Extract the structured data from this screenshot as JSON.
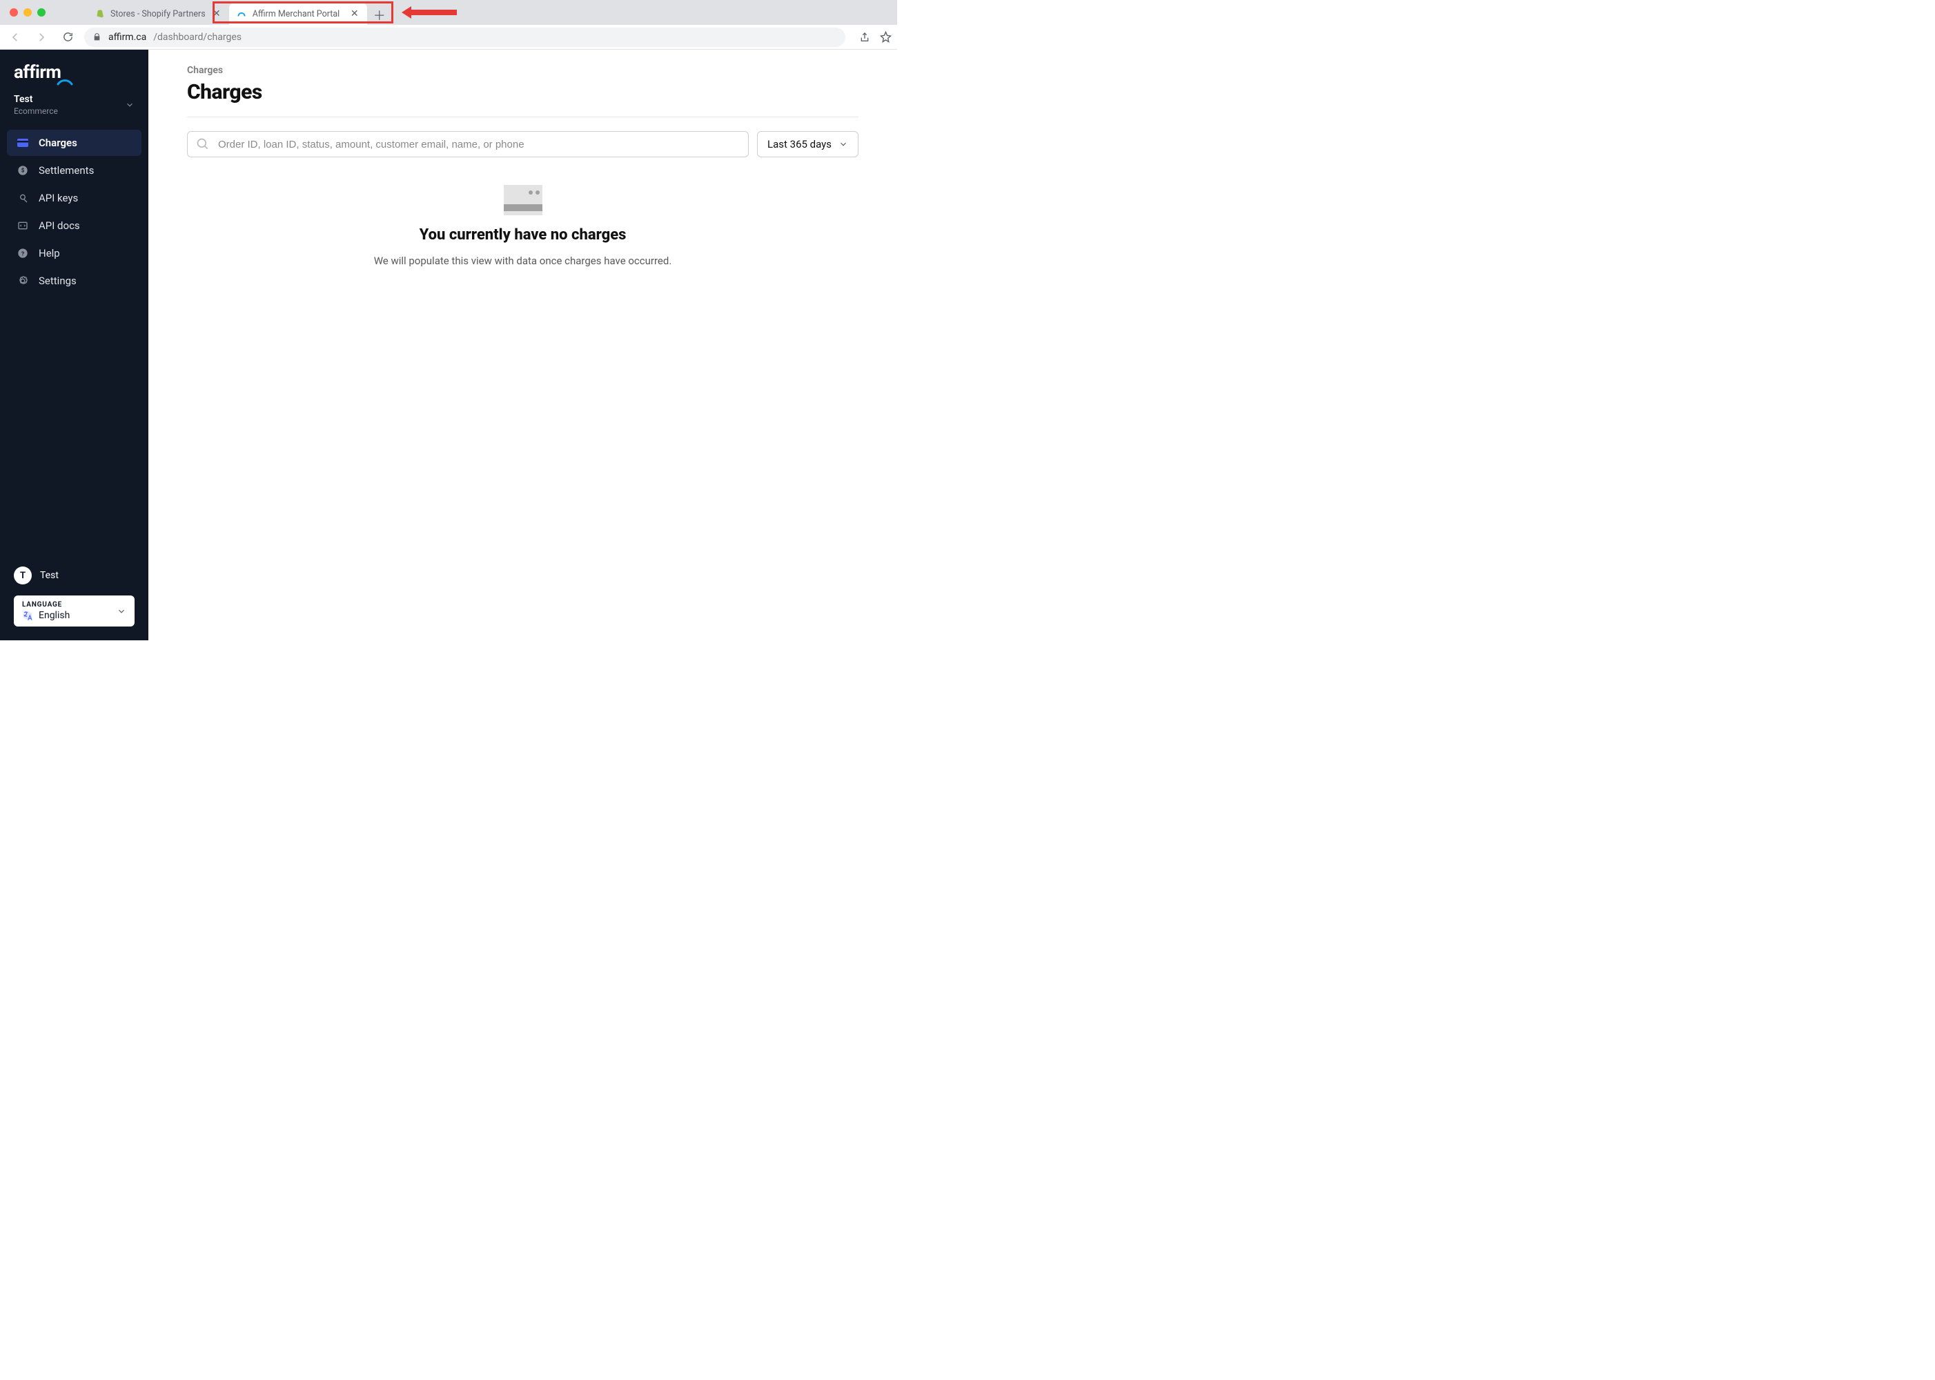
{
  "browser": {
    "tabs": [
      {
        "title": "Stores - Shopify Partners",
        "active": false
      },
      {
        "title": "Affirm Merchant Portal",
        "active": true
      }
    ],
    "url_host": "affirm.ca",
    "url_path": "/dashboard/charges"
  },
  "sidebar": {
    "brand": "affirm",
    "store": {
      "name": "Test",
      "type": "Ecommerce"
    },
    "nav": [
      {
        "key": "charges",
        "label": "Charges",
        "active": true
      },
      {
        "key": "settlements",
        "label": "Settlements"
      },
      {
        "key": "api-keys",
        "label": "API keys"
      },
      {
        "key": "api-docs",
        "label": "API docs"
      },
      {
        "key": "help",
        "label": "Help"
      },
      {
        "key": "settings",
        "label": "Settings"
      }
    ],
    "user": {
      "initial": "T",
      "name": "Test"
    },
    "language": {
      "label": "LANGUAGE",
      "value": "English"
    }
  },
  "page": {
    "breadcrumb": "Charges",
    "title": "Charges",
    "search_placeholder": "Order ID, loan ID, status, amount, customer email, name, or phone",
    "date_filter": "Last 365 days",
    "empty_title": "You currently have no charges",
    "empty_text": "We will populate this view with data once charges have occurred."
  }
}
